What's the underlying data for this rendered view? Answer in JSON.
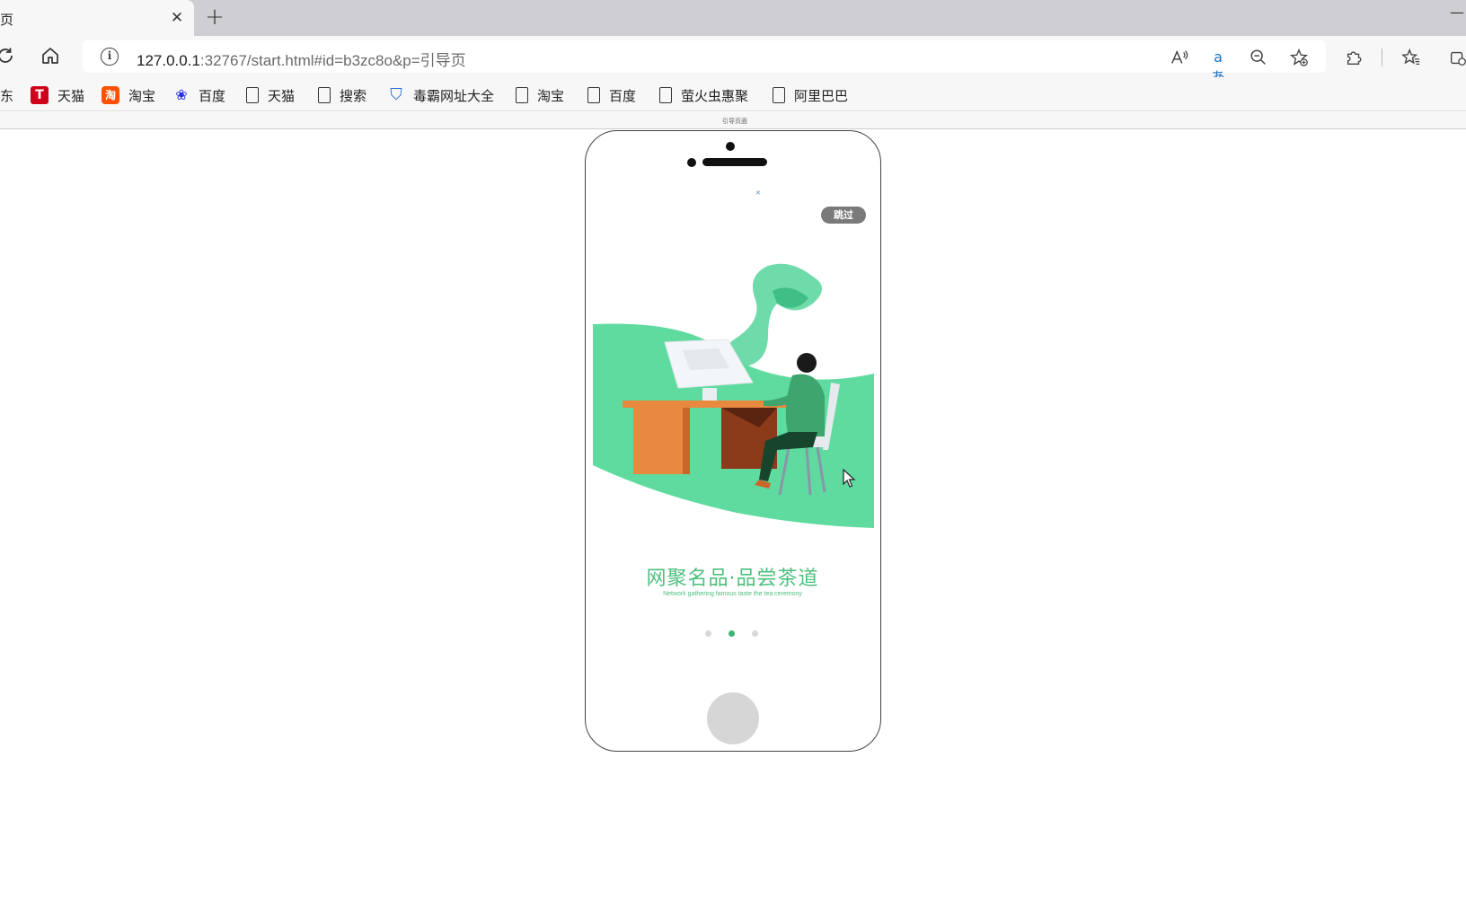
{
  "browser": {
    "tab_title": "页",
    "tab_close": "✕",
    "new_tab": "+",
    "url_host": "127.0.0.1",
    "url_rest": ":32767/start.html#id=b3zc8o&p=引导页",
    "bookmarks": [
      {
        "label": "东",
        "icon": "none"
      },
      {
        "label": "天猫",
        "icon": "tmall-icon"
      },
      {
        "label": "淘宝",
        "icon": "taobao-icon"
      },
      {
        "label": "百度",
        "icon": "baidu-icon"
      },
      {
        "label": "天猫",
        "icon": "page-icon"
      },
      {
        "label": "搜索",
        "icon": "page-icon"
      },
      {
        "label": "毒霸网址大全",
        "icon": "shield-icon"
      },
      {
        "label": "淘宝",
        "icon": "page-icon"
      },
      {
        "label": "百度",
        "icon": "page-icon"
      },
      {
        "label": "萤火虫惠聚",
        "icon": "page-icon"
      },
      {
        "label": "阿里巴巴",
        "icon": "page-icon"
      }
    ],
    "strip_label": "引导页面"
  },
  "phone": {
    "skip_label": "跳过",
    "tiny_mark": "✕",
    "slogan_cn": "网聚名品·品尝茶道",
    "slogan_en": "Network gathering famous taste the tea ceremony",
    "pager": {
      "count": 3,
      "active_index": 1
    }
  },
  "colors": {
    "accent_green": "#4dbf7d",
    "illustration_green": "#5fdba0",
    "desk_orange": "#e8893f",
    "skip_bg": "#7a7a7a"
  }
}
